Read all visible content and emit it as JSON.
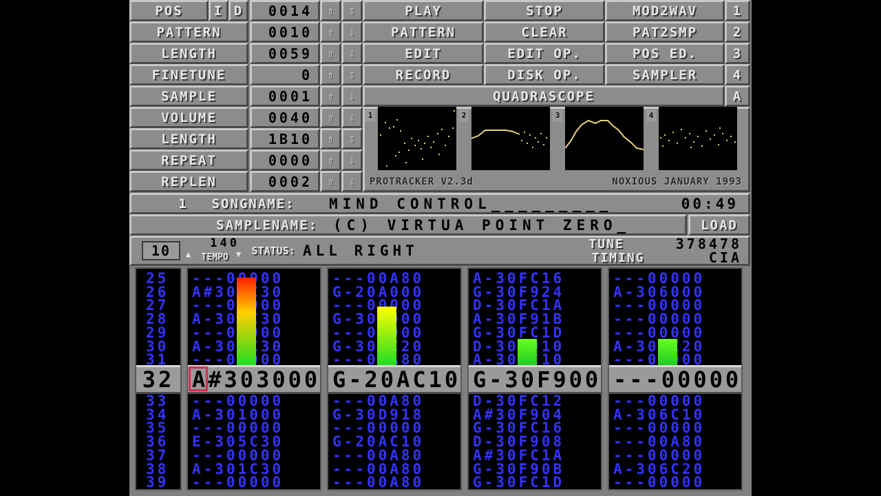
{
  "menu": {
    "pos_label": "POS",
    "i_label": "I",
    "d_label": "D",
    "pos_value": "0014",
    "pattern_label": "PATTERN",
    "pattern_value": "0010",
    "length_label": "LENGTH",
    "length_value": "0059",
    "finetune_label": "FINETUNE",
    "finetune_value": "0",
    "sample_label": "SAMPLE",
    "sample_value": "0001",
    "volume_label": "VOLUME",
    "volume_value": "0040",
    "slength_label": "LENGTH",
    "slength_value": "1B10",
    "repeat_label": "REPEAT",
    "repeat_value": "0000",
    "replen_label": "REPLEN",
    "replen_value": "0002",
    "up": "⇧",
    "down": "⇩"
  },
  "buttons": {
    "play": "PLAY",
    "stop": "STOP",
    "mod2wav": "MOD2WAV",
    "one": "1",
    "pattern": "PATTERN",
    "clear": "CLEAR",
    "pat2smp": "PAT2SMP",
    "two": "2",
    "edit": "EDIT",
    "edit_op": "EDIT OP.",
    "pos_ed": "POS ED.",
    "three": "3",
    "record": "RECORD",
    "disk_op": "DISK OP.",
    "sampler": "SAMPLER",
    "four": "4",
    "quadrascope": "QUADRASCOPE",
    "a": "A",
    "load": "LOAD"
  },
  "scope": {
    "ch": [
      "1",
      "2",
      "3",
      "4"
    ],
    "version": "PROTRACKER V2.3d",
    "credit": "NOXIOUS JANUARY 1993"
  },
  "song": {
    "num": "1",
    "songname_label": "SONGNAME:",
    "songname": "MIND CONTROL_________",
    "time": "00:49"
  },
  "sample": {
    "samplename_label": "SAMPLENAME:",
    "samplename": "(C) VIRTUA POINT ZERO_"
  },
  "status": {
    "pattern_box": "10",
    "tempo_value": "140",
    "tempo_label": "TEMPO",
    "status_label": "STATUS:",
    "status_text": "ALL RIGHT",
    "tune_label": "TUNE",
    "tune_value": "378478",
    "timing_label": "TIMING",
    "timing_value": "CIA"
  },
  "pattern": {
    "rows_top": [
      "25",
      "26",
      "27",
      "28",
      "29",
      "30",
      "31"
    ],
    "rows_bottom": [
      "33",
      "34",
      "35",
      "36",
      "37",
      "38",
      "39"
    ],
    "current_row": "32",
    "ch1_top": [
      "---00000",
      "A#303C30",
      "---00000",
      "A-304C30",
      "---00000",
      "A-301C30",
      "---00000"
    ],
    "ch2_top": [
      "---00A80",
      "G-20A000",
      "---00000",
      "G-30A000",
      "---00000",
      "G-30DC20",
      "---00A80"
    ],
    "ch3_top": [
      "A-30FC16",
      "G-30F924",
      "D-30FC1A",
      "A-30F91B",
      "G-30FC1D",
      "D-30F910",
      "A-30FC10"
    ],
    "ch4_top": [
      "---00000",
      "A-306000",
      "---00000",
      "---00000",
      "---00000",
      "A-306C20",
      "---00000"
    ],
    "ch1_cur": "A#303000",
    "ch2_cur": "G-20AC10",
    "ch3_cur": "G-30F900",
    "ch4_cur": "---00000",
    "ch1_bot": [
      "---00000",
      "A-301000",
      "---00000",
      "E-305C30",
      "---00000",
      "A-301C30",
      "---00000"
    ],
    "ch2_bot": [
      "---00A80",
      "G-30D918",
      "---00000",
      "G-20AC10",
      "---00A80",
      "---00A80",
      "---00A80"
    ],
    "ch3_bot": [
      "D-30FC12",
      "A#30F904",
      "G-30FC16",
      "D-30F908",
      "A#30FC1A",
      "G-30F90B",
      "G-30FC1D"
    ],
    "ch4_bot": [
      "---00000",
      "A-306C10",
      "---00000",
      "---00A80",
      "---00000",
      "A-306C20",
      "---00000"
    ]
  },
  "vu_levels": [
    0.87,
    0.58,
    0.26,
    0.26
  ],
  "colors": {
    "pattern_text": "#3333ff",
    "scope_trace": "#e8d27a",
    "panel": "#8c8c8c",
    "cursor": "#d03050"
  }
}
